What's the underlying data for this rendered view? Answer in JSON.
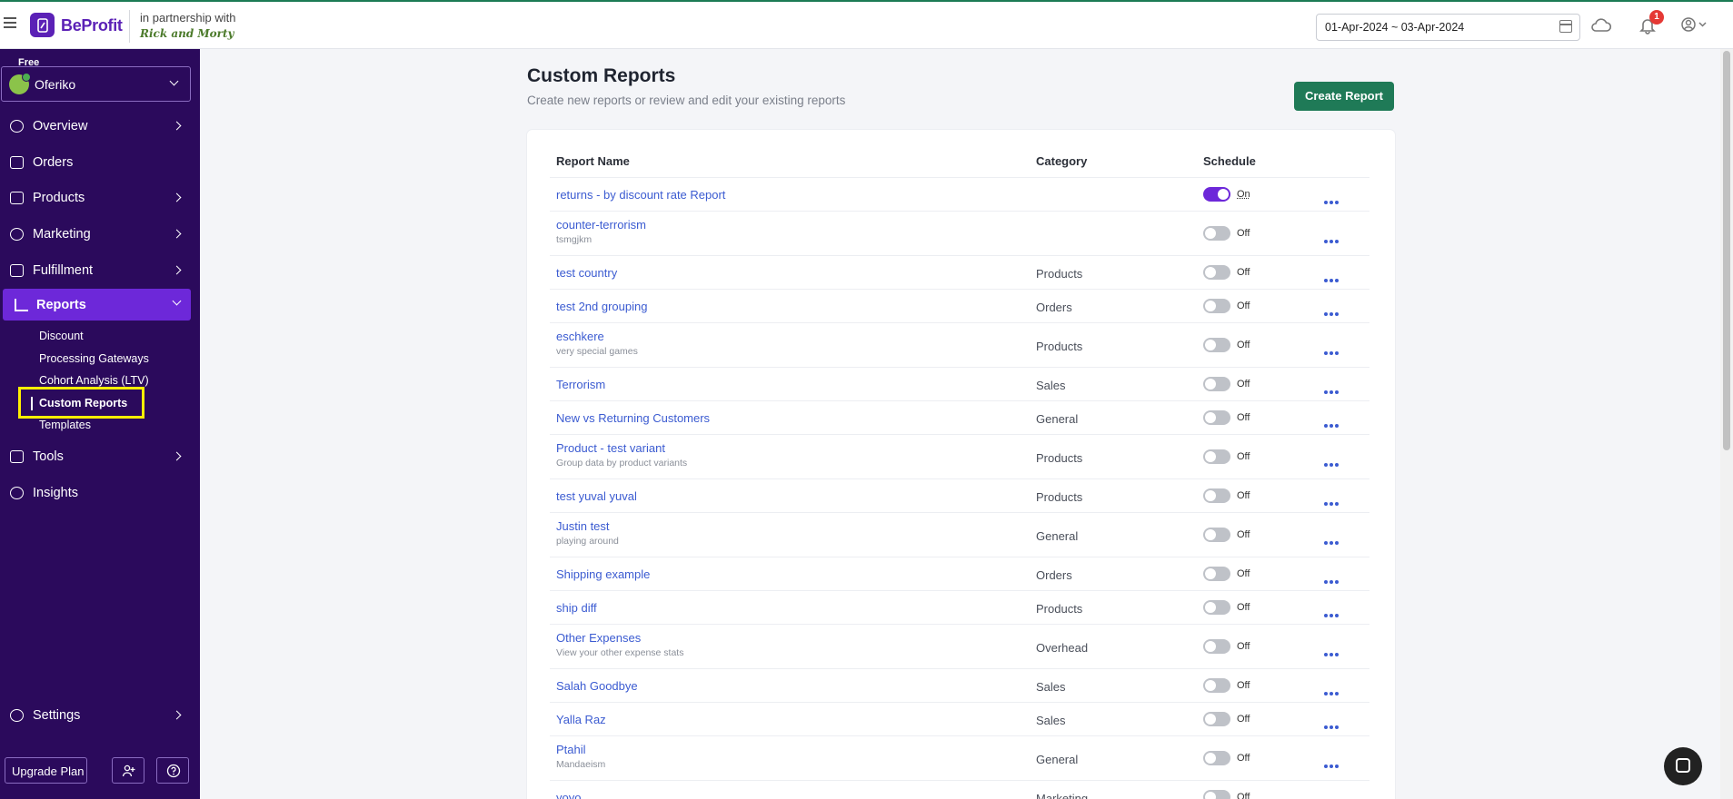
{
  "app": {
    "name": "BeProfit",
    "partner_text": "in partnership with",
    "partner_logo": "Rick and Morty"
  },
  "header": {
    "date_range": "01-Apr-2024 ~ 03-Apr-2024",
    "notification_count": "1"
  },
  "sidebar": {
    "plan_label": "Free",
    "store_name": "Oferiko",
    "items": [
      {
        "label": "Overview",
        "icon": "overview-icon"
      },
      {
        "label": "Orders",
        "icon": "cart-icon"
      },
      {
        "label": "Products",
        "icon": "bag-icon"
      },
      {
        "label": "Marketing",
        "icon": "target-icon"
      },
      {
        "label": "Fulfillment",
        "icon": "truck-icon"
      },
      {
        "label": "Reports",
        "icon": "bar-chart-icon"
      },
      {
        "label": "Tools",
        "icon": "tools-icon"
      },
      {
        "label": "Insights",
        "icon": "bulb-icon"
      },
      {
        "label": "Settings",
        "icon": "gear-icon"
      }
    ],
    "report_subitems": [
      "Discount",
      "Processing Gateways",
      "Cohort Analysis (LTV)",
      "Custom Reports",
      "Templates"
    ],
    "upgrade_label": "Upgrade Plan"
  },
  "page": {
    "title": "Custom Reports",
    "subtitle": "Create new reports or review and edit your existing reports",
    "create_button": "Create Report"
  },
  "table": {
    "headers": {
      "name": "Report Name",
      "category": "Category",
      "schedule": "Schedule"
    },
    "rows": [
      {
        "name": "returns - by discount rate Report",
        "desc": "",
        "category": "",
        "schedule": "On"
      },
      {
        "name": "counter-terrorism",
        "desc": "tsmgjkm",
        "category": "",
        "schedule": "Off"
      },
      {
        "name": "test country",
        "desc": "",
        "category": "Products",
        "schedule": "Off"
      },
      {
        "name": "test 2nd grouping",
        "desc": "",
        "category": "Orders",
        "schedule": "Off"
      },
      {
        "name": "eschkere",
        "desc": "very special games",
        "category": "Products",
        "schedule": "Off"
      },
      {
        "name": "Terrorism",
        "desc": "",
        "category": "Sales",
        "schedule": "Off"
      },
      {
        "name": "New vs Returning Customers",
        "desc": "",
        "category": "General",
        "schedule": "Off"
      },
      {
        "name": "Product - test variant",
        "desc": "Group data by product variants",
        "category": "Products",
        "schedule": "Off"
      },
      {
        "name": "test yuval yuval",
        "desc": "",
        "category": "Products",
        "schedule": "Off"
      },
      {
        "name": "Justin test",
        "desc": "playing around",
        "category": "General",
        "schedule": "Off"
      },
      {
        "name": "Shipping example",
        "desc": "",
        "category": "Orders",
        "schedule": "Off"
      },
      {
        "name": "ship diff",
        "desc": "",
        "category": "Products",
        "schedule": "Off"
      },
      {
        "name": "Other Expenses",
        "desc": "View your other expense stats",
        "category": "Overhead",
        "schedule": "Off"
      },
      {
        "name": "Salah Goodbye",
        "desc": "",
        "category": "Sales",
        "schedule": "Off"
      },
      {
        "name": "Yalla Raz",
        "desc": "",
        "category": "Sales",
        "schedule": "Off"
      },
      {
        "name": "Ptahil",
        "desc": "Mandaeism",
        "category": "General",
        "schedule": "Off"
      },
      {
        "name": "yoyo",
        "desc": "",
        "category": "Marketing",
        "schedule": "Off"
      }
    ]
  },
  "colors": {
    "brand": "#5b21b6",
    "sidebar_bg": "#2b0a5c",
    "active": "#6d28d9",
    "create_button": "#1f7a57",
    "link": "#3b5bd1",
    "highlight": "#ffef00"
  }
}
